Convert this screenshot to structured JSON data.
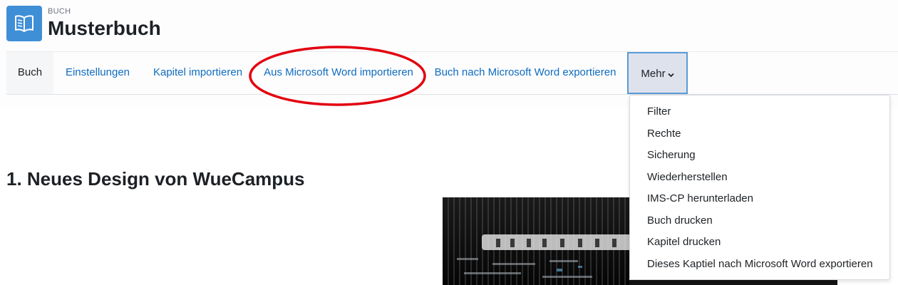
{
  "header": {
    "kind_label": "BUCH",
    "title": "Musterbuch",
    "icon": "book-icon"
  },
  "nav": {
    "tabs": [
      {
        "label": "Buch",
        "active": true
      },
      {
        "label": "Einstellungen"
      },
      {
        "label": "Kapitel importieren"
      },
      {
        "label": "Aus Microsoft Word importieren"
      },
      {
        "label": "Buch nach Microsoft Word exportieren"
      },
      {
        "label": "Mehr",
        "expanded": true,
        "icon": "chevron-down-icon"
      }
    ]
  },
  "dropdown": {
    "items": [
      {
        "label": "Filter"
      },
      {
        "label": "Rechte"
      },
      {
        "label": "Sicherung"
      },
      {
        "label": "Wiederherstellen"
      },
      {
        "label": "IMS-CP herunterladen"
      },
      {
        "label": "Buch drucken"
      },
      {
        "label": "Kapitel drucken"
      },
      {
        "label": "Dieses Kaptiel nach Microsoft Word exportieren"
      }
    ]
  },
  "content": {
    "heading": "1. Neues Design von WueCampus",
    "image_alt": "WueCampus"
  },
  "colors": {
    "link": "#0f6cbf",
    "icon_bg": "#3f8fd6",
    "annotation": "#e3000f",
    "more_bg": "#dee2ed",
    "more_border": "#5b9bd6"
  }
}
